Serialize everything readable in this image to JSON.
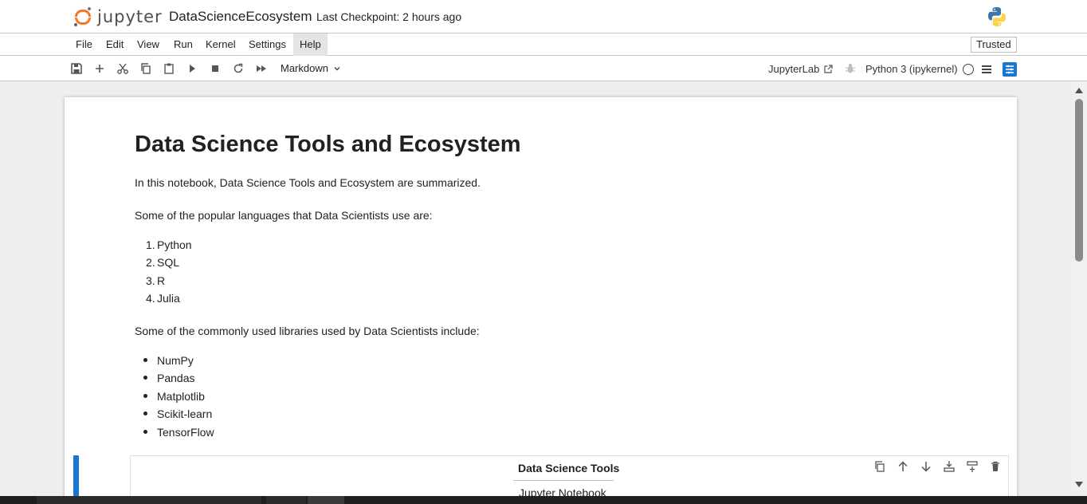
{
  "header": {
    "logo_text": "jupyter",
    "notebook_title": "DataScienceEcosystem",
    "checkpoint": "Last Checkpoint: 2 hours ago",
    "kernel_logo_icon": "python-logo-icon"
  },
  "menubar": {
    "items": [
      "File",
      "Edit",
      "View",
      "Run",
      "Kernel",
      "Settings",
      "Help"
    ],
    "active": "Help",
    "trusted_label": "Trusted"
  },
  "toolbar": {
    "cell_type": "Markdown",
    "jupyterlab_label": "JupyterLab",
    "kernel_name": "Python 3 (ipykernel)",
    "accent_color": "#1976d2"
  },
  "notebook": {
    "heading": "Data Science Tools and Ecosystem",
    "intro": "In this notebook, Data Science Tools and Ecosystem are summarized.",
    "languages_intro": "Some of the popular languages that Data Scientists use are:",
    "languages": [
      "Python",
      "SQL",
      "R",
      "Julia"
    ],
    "libraries_intro": "Some of the commonly used libraries used by Data Scientists include:",
    "libraries": [
      "NumPy",
      "Pandas",
      "Matplotlib",
      "Scikit-learn",
      "TensorFlow"
    ],
    "active_cell": {
      "table_header": "Data Science Tools",
      "first_row": "Jupyter Notebook"
    }
  }
}
